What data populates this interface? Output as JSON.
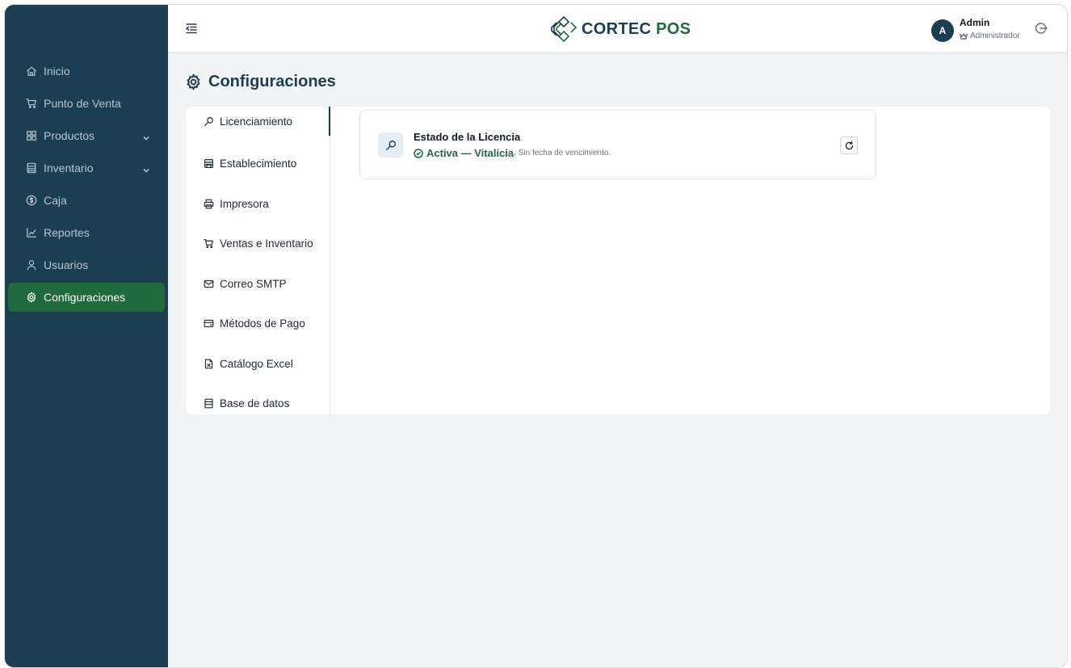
{
  "app": {
    "brand_part1": "CORTEC",
    "brand_part2": "POS"
  },
  "colors": {
    "sidebar_bg": "#1c3e52",
    "accent_green": "#1f6b3c",
    "page_bg": "#f1f3f5"
  },
  "user": {
    "initial": "A",
    "name": "Admin",
    "role": "Administrador"
  },
  "sidebar": {
    "items": [
      {
        "label": "Inicio",
        "icon": "home-icon"
      },
      {
        "label": "Punto de Venta",
        "icon": "cart-icon"
      },
      {
        "label": "Productos",
        "icon": "grid-icon",
        "expandable": true
      },
      {
        "label": "Inventario",
        "icon": "list-icon",
        "expandable": true
      },
      {
        "label": "Caja",
        "icon": "dollar-circle-icon"
      },
      {
        "label": "Reportes",
        "icon": "line-chart-icon"
      },
      {
        "label": "Usuarios",
        "icon": "user-icon"
      },
      {
        "label": "Configuraciones",
        "icon": "gear-icon",
        "active": true
      }
    ]
  },
  "page": {
    "title": "Configuraciones"
  },
  "settings_nav": {
    "items": [
      {
        "label": "Licenciamiento",
        "icon": "key-icon",
        "active": true
      },
      {
        "label": "Establecimiento",
        "icon": "store-icon"
      },
      {
        "label": "Impresora",
        "icon": "printer-icon"
      },
      {
        "label": "Ventas e Inventario",
        "icon": "cart-icon"
      },
      {
        "label": "Correo SMTP",
        "icon": "mail-icon"
      },
      {
        "label": "Métodos de Pago",
        "icon": "credit-card-icon"
      },
      {
        "label": "Catálogo Excel",
        "icon": "excel-file-icon"
      },
      {
        "label": "Base de datos",
        "icon": "database-icon"
      }
    ]
  },
  "license": {
    "title": "Estado de la Licencia",
    "status": "Activa — Vitalicia",
    "note": ". Sin fecha de vencimiento."
  }
}
